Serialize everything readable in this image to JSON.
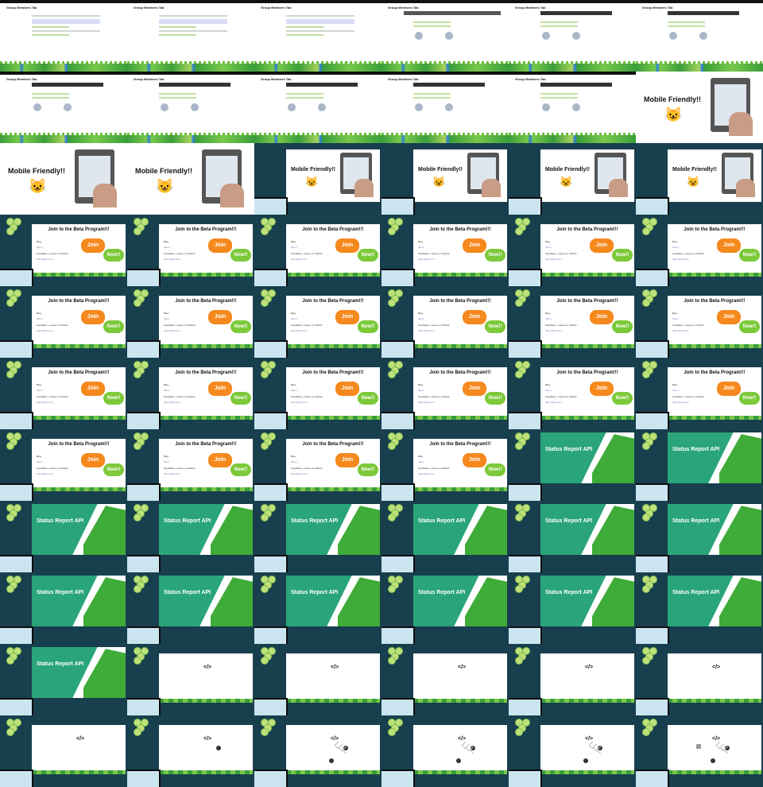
{
  "screencast": {
    "title": "Group Members Tab"
  },
  "mobile": {
    "title": "Mobile Friendly!!",
    "cat_icon": "smiling-cat-emoji",
    "speaker_tag": "Mobile F"
  },
  "beta": {
    "title": "Join to the Beta Program!!!",
    "blog_label": "Blog",
    "blog_url": "https://...",
    "feedback_label": "Feedback + issues on GitHub",
    "feedback_url": "https://github.com/...",
    "join_label": "Join",
    "now_label": "Now!!",
    "speaker_tag": "Join"
  },
  "status": {
    "title": "Status Report API",
    "speaker_tag": "Status Re"
  },
  "code": {
    "tag": "</>"
  },
  "colors": {
    "talk_background": "#183f4e",
    "join_orange": "#f5891d",
    "now_green": "#7cc93a",
    "status_teal": "#2aa57a",
    "status_green": "#3fab38"
  }
}
